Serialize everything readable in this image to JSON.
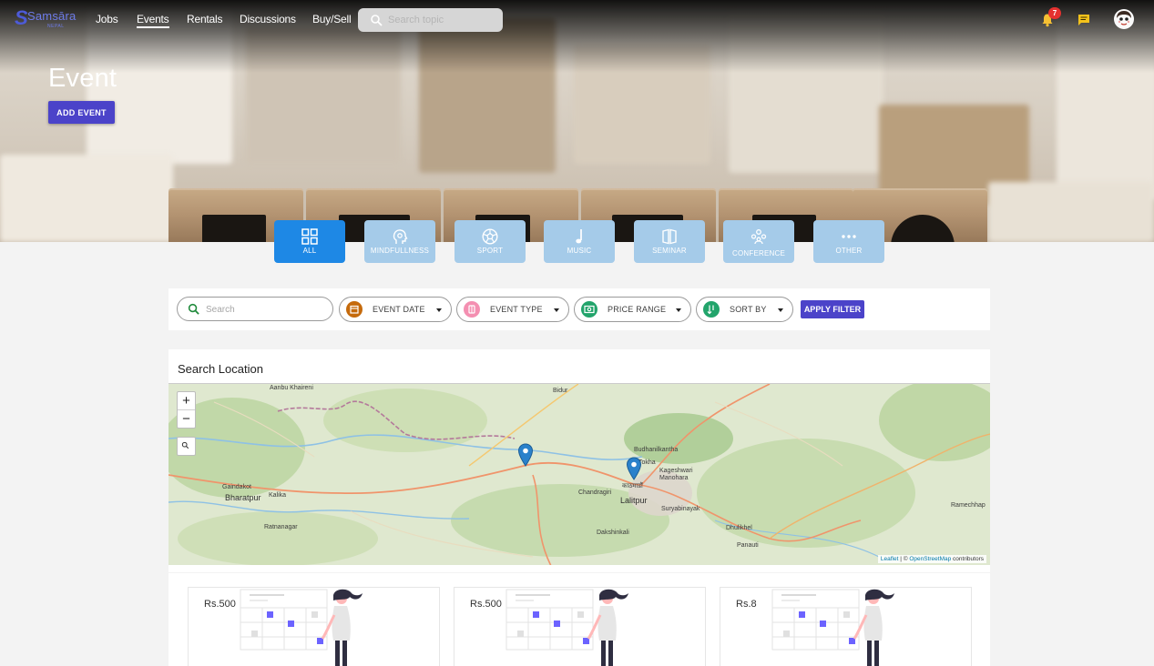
{
  "nav": {
    "logo_text": "Samsāra",
    "logo_sub": "NEPAL",
    "links": [
      {
        "label": "Jobs"
      },
      {
        "label": "Events"
      },
      {
        "label": "Rentals"
      },
      {
        "label": "Discussions"
      },
      {
        "label": "Buy/Sell"
      }
    ],
    "active": "Events",
    "search_placeholder": "Search topic",
    "notification_count": "7"
  },
  "hero": {
    "title": "Event",
    "add_button": "ADD EVENT"
  },
  "categories": [
    {
      "label": "ALL",
      "icon": "grid-icon",
      "active": true
    },
    {
      "label": "MINDFULLNESS",
      "icon": "head-icon",
      "active": false
    },
    {
      "label": "SPORT",
      "icon": "football-icon",
      "active": false
    },
    {
      "label": "MUSIC",
      "icon": "music-note-icon",
      "active": false
    },
    {
      "label": "SEMINAR",
      "icon": "seminar-icon",
      "active": false
    },
    {
      "label": "CONFERENCE",
      "icon": "people-icon",
      "active": false
    },
    {
      "label": "OTHER",
      "icon": "more-icon",
      "active": false
    }
  ],
  "filters": {
    "search_placeholder": "Search",
    "event_date": "EVENT DATE",
    "event_type": "EVENT TYPE",
    "price_range": "PRICE RANGE",
    "sort_by": "SORT BY",
    "apply": "APPLY FILTER"
  },
  "map": {
    "title": "Search Location",
    "zoom_in": "+",
    "zoom_out": "−",
    "places": [
      {
        "name": "Aanbu Khaireni",
        "big": false
      },
      {
        "name": "Bidur",
        "big": false
      },
      {
        "name": "Budhanilkantha",
        "big": false
      },
      {
        "name": "Tokha",
        "big": false
      },
      {
        "name": "Kageshwari Manohara",
        "big": false
      },
      {
        "name": "काठमाडौं",
        "big": false
      },
      {
        "name": "Chandragiri",
        "big": false
      },
      {
        "name": "Lalitpur",
        "big": true
      },
      {
        "name": "Suryabinayak",
        "big": false
      },
      {
        "name": "Gaindakot",
        "big": false
      },
      {
        "name": "Bharatpur",
        "big": true
      },
      {
        "name": "Kalika",
        "big": false
      },
      {
        "name": "Ratnanagar",
        "big": false
      },
      {
        "name": "Dakshinkali",
        "big": false
      },
      {
        "name": "Dhulikhel",
        "big": false
      },
      {
        "name": "Panauti",
        "big": false
      },
      {
        "name": "Ramechhap",
        "big": false
      }
    ],
    "attribution_leaflet": "Leaflet",
    "attribution_osm": "OpenStreetMap",
    "attribution_rest": "contributors"
  },
  "events": [
    {
      "price": "Rs.500"
    },
    {
      "price": "Rs.500"
    },
    {
      "price": "Rs.8"
    }
  ],
  "colors": {
    "primary_button": "#4b43c9",
    "category_active": "#1e88e5",
    "category_inactive": "#a5cbe9",
    "badge": "#e5312f",
    "bell": "#f6c033",
    "chat": "#f4c21b"
  }
}
